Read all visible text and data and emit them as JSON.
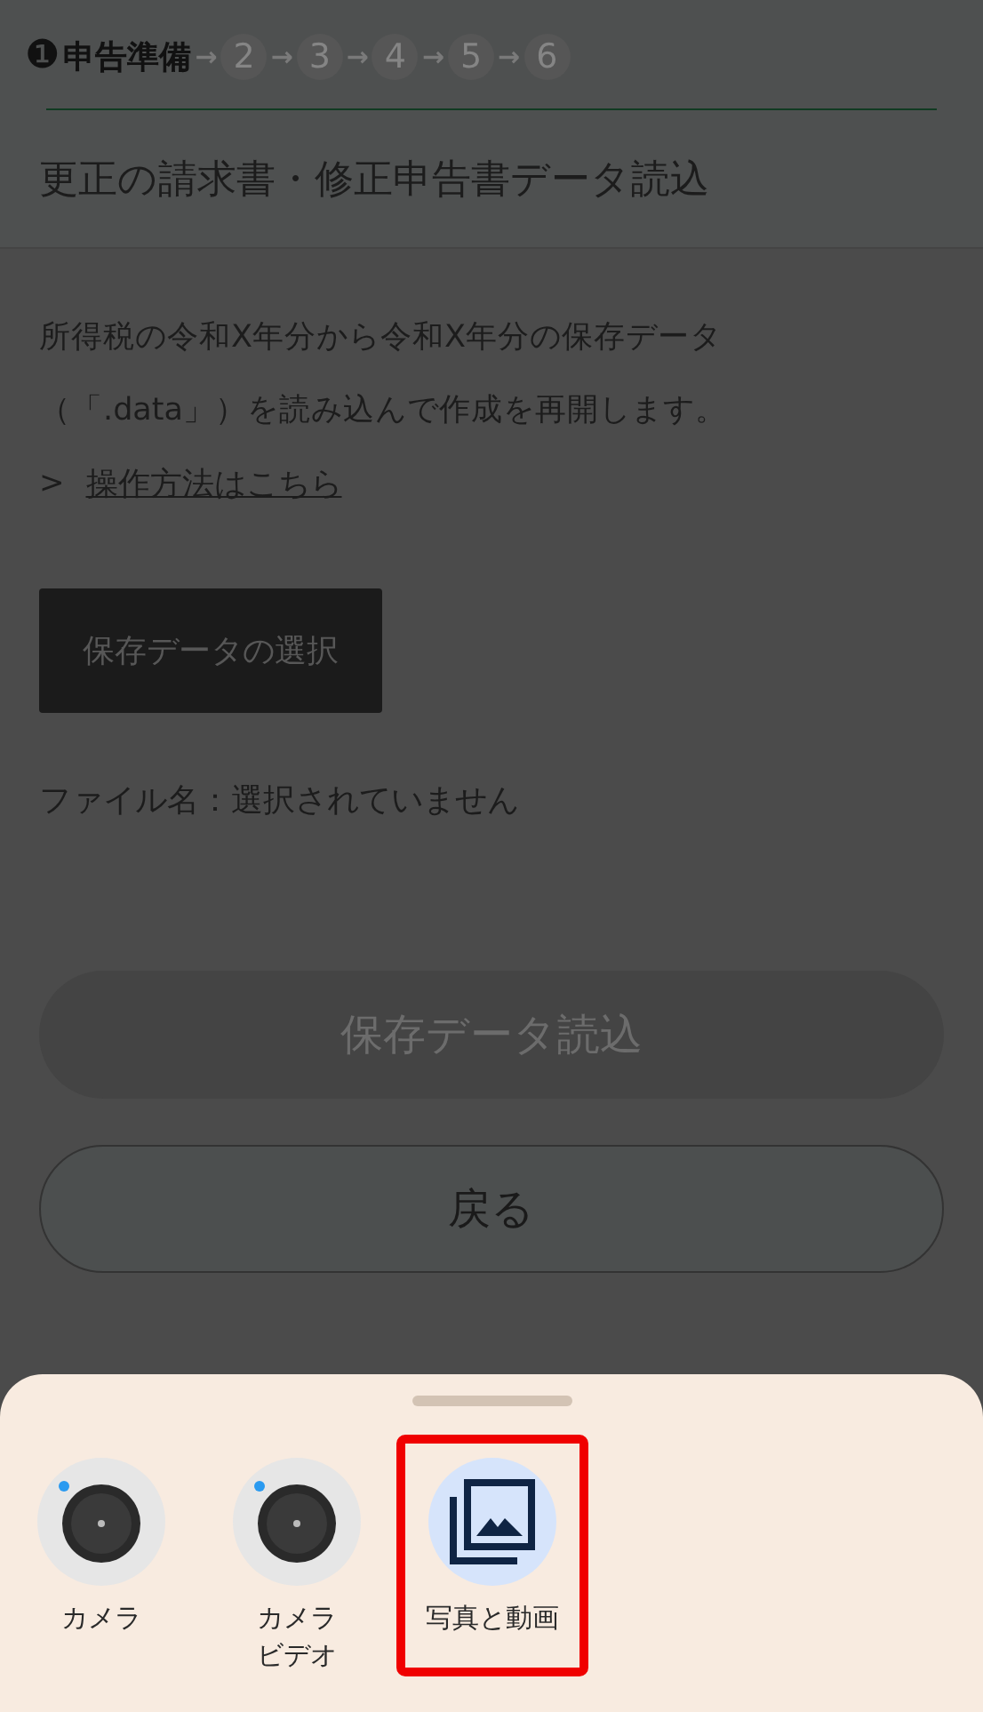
{
  "steps": [
    {
      "number": "❶",
      "label": "申告準備",
      "selected": true
    },
    {
      "number": "2",
      "selected": false
    },
    {
      "number": "3",
      "selected": false
    },
    {
      "number": "4",
      "selected": false
    },
    {
      "number": "5",
      "selected": false
    },
    {
      "number": "6",
      "selected": false
    }
  ],
  "step_arrow": "→",
  "title": "更正の請求書・修正申告書データ読込",
  "description": [
    "所得税の令和X年分から令和X年分の保存データ",
    "（「.data」）を読み込んで作成を再開します。"
  ],
  "help_link": {
    "chevron": ">",
    "label": "操作方法はこちら"
  },
  "select_button": "保存データの選択",
  "file_name": "ファイル名：選択されていません",
  "load_button": {
    "label": "保存データ読込",
    "disabled": true
  },
  "back_button": "戻る",
  "sheet": {
    "options": [
      {
        "kind": "camera",
        "label": [
          "カメラ"
        ],
        "selected": false
      },
      {
        "kind": "camera",
        "label": [
          "カメラ",
          "ビデオ"
        ],
        "selected": false
      },
      {
        "kind": "gallery",
        "label": [
          "写真と動画"
        ],
        "selected": true
      }
    ]
  }
}
